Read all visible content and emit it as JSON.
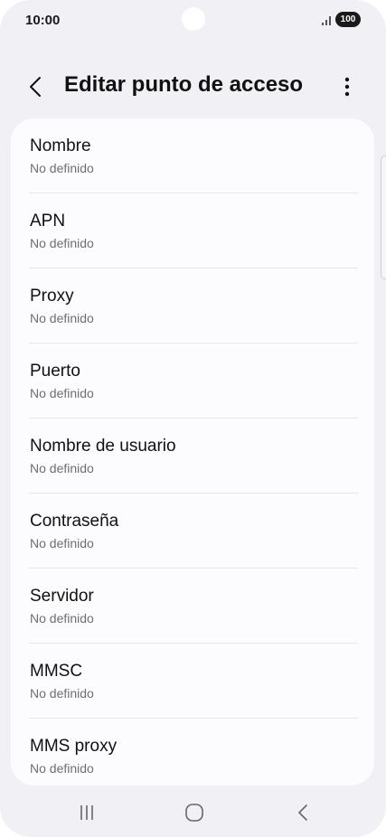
{
  "status_bar": {
    "time": "10:00",
    "battery": "100"
  },
  "header": {
    "title": "Editar punto de acceso"
  },
  "settings": [
    {
      "label": "Nombre",
      "value": "No definido"
    },
    {
      "label": "APN",
      "value": "No definido"
    },
    {
      "label": "Proxy",
      "value": "No definido"
    },
    {
      "label": "Puerto",
      "value": "No definido"
    },
    {
      "label": "Nombre de usuario",
      "value": "No definido"
    },
    {
      "label": "Contraseña",
      "value": "No definido"
    },
    {
      "label": "Servidor",
      "value": "No definido"
    },
    {
      "label": "MMSC",
      "value": "No definido"
    },
    {
      "label": "MMS proxy",
      "value": "No definido"
    }
  ],
  "icons": {
    "back": "chevron-left-icon",
    "more": "more-vertical-icon",
    "signal": "signal-icon",
    "nav_recents": "recents-icon",
    "nav_home": "home-icon",
    "nav_back": "back-icon"
  }
}
